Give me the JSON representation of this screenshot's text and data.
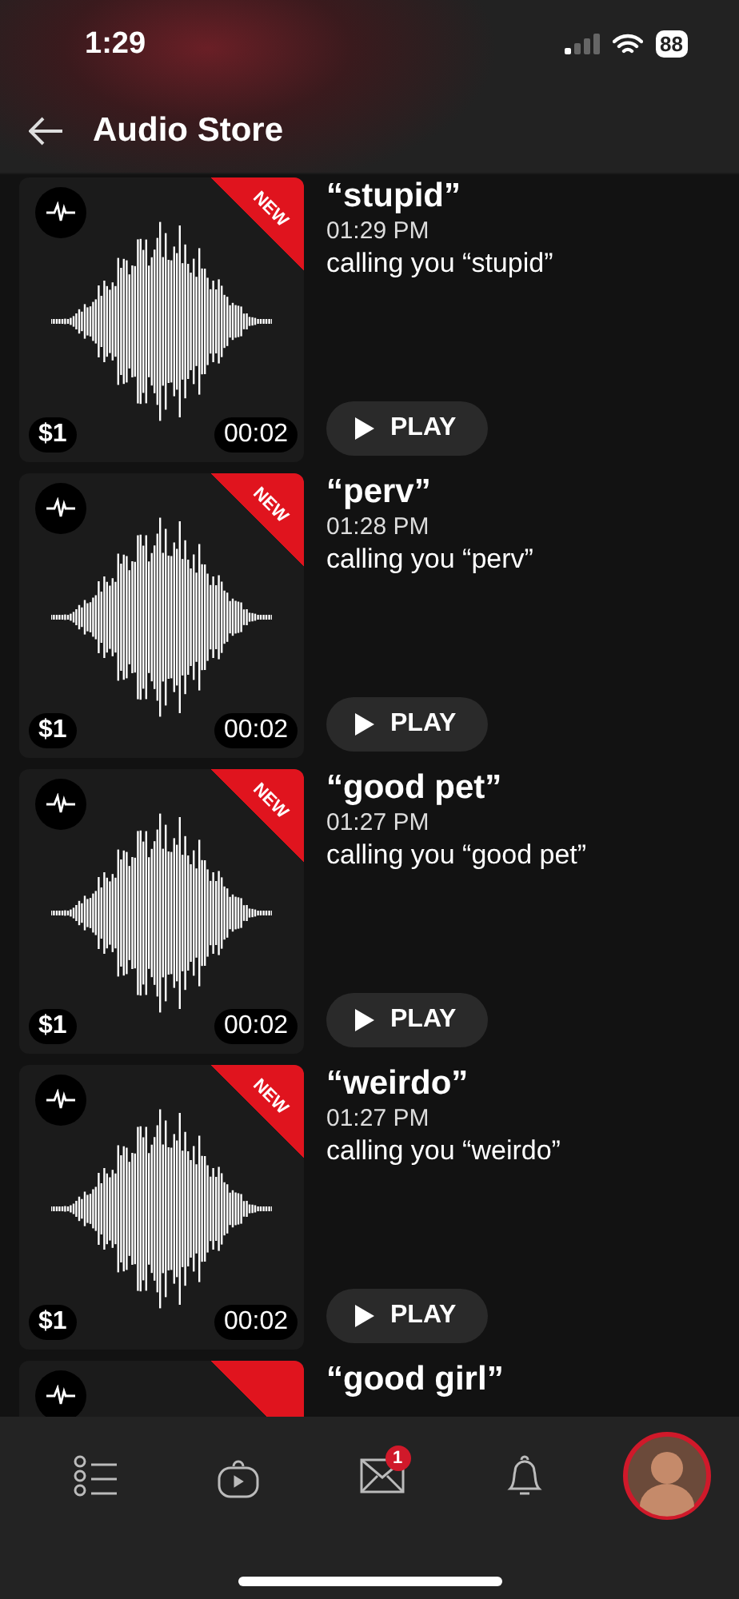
{
  "status_bar": {
    "time": "1:29",
    "battery": "88"
  },
  "header": {
    "title": "Audio Store"
  },
  "items": [
    {
      "title": "“stupid”",
      "time": "01:29 PM",
      "subtitle": "calling you “stupid”",
      "price": "$1",
      "duration": "00:02",
      "badge": "NEW",
      "play_label": "PLAY"
    },
    {
      "title": "“perv”",
      "time": "01:28 PM",
      "subtitle": "calling you “perv”",
      "price": "$1",
      "duration": "00:02",
      "badge": "NEW",
      "play_label": "PLAY"
    },
    {
      "title": "“good pet”",
      "time": "01:27 PM",
      "subtitle": "calling you “good pet”",
      "price": "$1",
      "duration": "00:02",
      "badge": "NEW",
      "play_label": "PLAY"
    },
    {
      "title": "“weirdo”",
      "time": "01:27 PM",
      "subtitle": "calling you “weirdo”",
      "price": "$1",
      "duration": "00:02",
      "badge": "NEW",
      "play_label": "PLAY"
    },
    {
      "title": "“good girl”"
    }
  ],
  "tab_bar": [
    {
      "kind": "list"
    },
    {
      "kind": "video"
    },
    {
      "kind": "mail",
      "badge": "1"
    },
    {
      "kind": "bell"
    },
    {
      "kind": "avatar"
    }
  ]
}
